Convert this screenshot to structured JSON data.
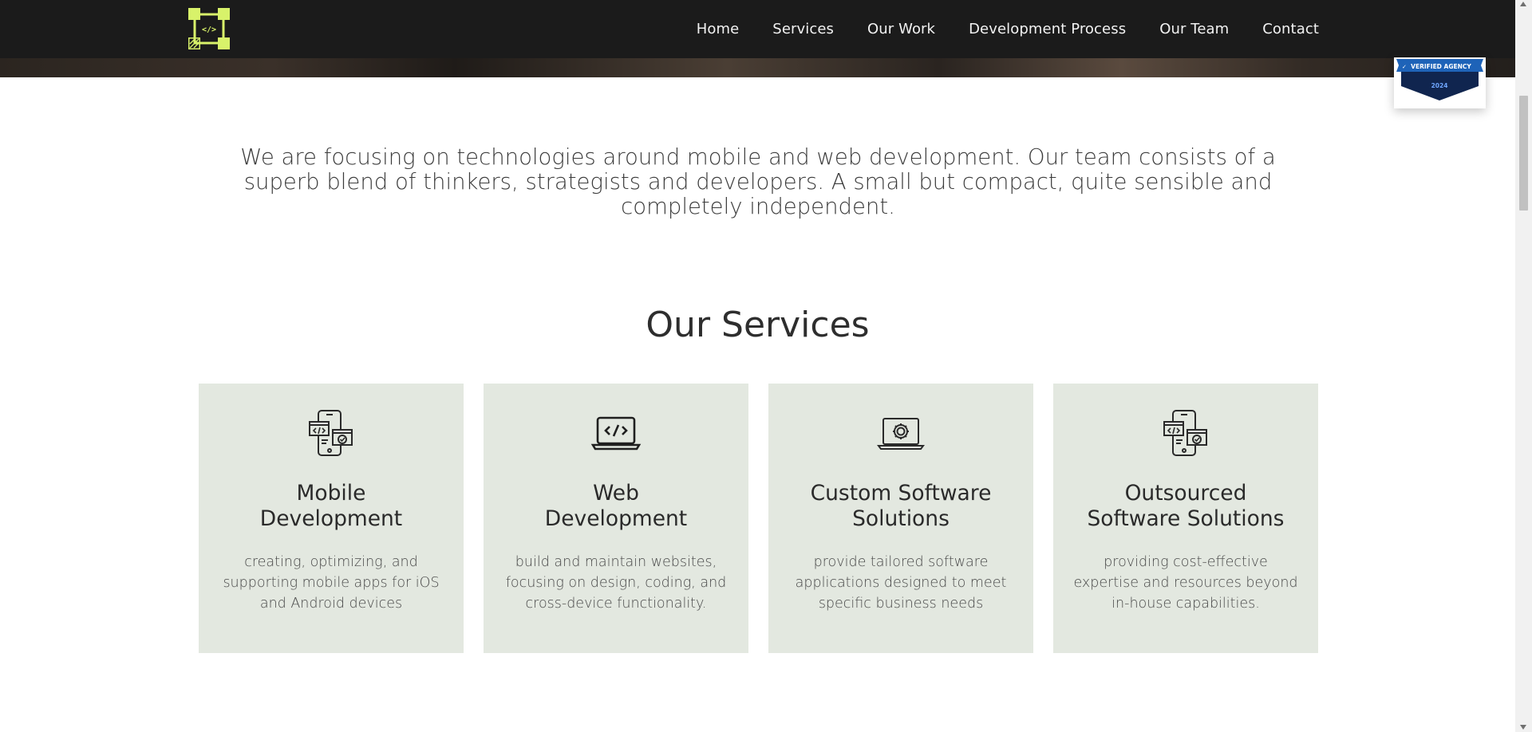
{
  "colors": {
    "nav_bg": "#1b1b1b",
    "logo_accent": "#d8f26a",
    "card_bg": "#e3e8e0",
    "badge_blue": "#1e63b8",
    "badge_navy": "#10254f"
  },
  "logo": {
    "icon": "code-brackets-logo-icon",
    "text": "</>"
  },
  "nav": {
    "items": [
      {
        "label": "Home"
      },
      {
        "label": "Services"
      },
      {
        "label": "Our Work"
      },
      {
        "label": "Development Process"
      },
      {
        "label": "Our Team"
      },
      {
        "label": "Contact"
      }
    ]
  },
  "badge": {
    "label": "VERIFIED AGENCY",
    "year": "2024"
  },
  "intro": {
    "text": "We are focusing on technologies around mobile and web development. Our team consists of a superb blend of thinkers, strategists and developers. A small but compact, quite sensible and completely independent."
  },
  "services": {
    "title": "Our Services",
    "cards": [
      {
        "icon": "mobile-code-icon",
        "title": "Mobile\nDevelopment",
        "description": "creating, optimizing, and supporting mobile apps for iOS and Android devices"
      },
      {
        "icon": "laptop-code-icon",
        "title": "Web\nDevelopment",
        "description": "build and maintain websites, focusing on design, coding, and cross-device functionality."
      },
      {
        "icon": "laptop-gear-icon",
        "title": "Custom Software\nSolutions",
        "description": "provide tailored software applications designed to meet specific business needs"
      },
      {
        "icon": "mobile-code-icon",
        "title": "Outsourced\nSoftware Solutions",
        "description": "providing cost-effective expertise and resources beyond in-house capabilities."
      }
    ]
  }
}
